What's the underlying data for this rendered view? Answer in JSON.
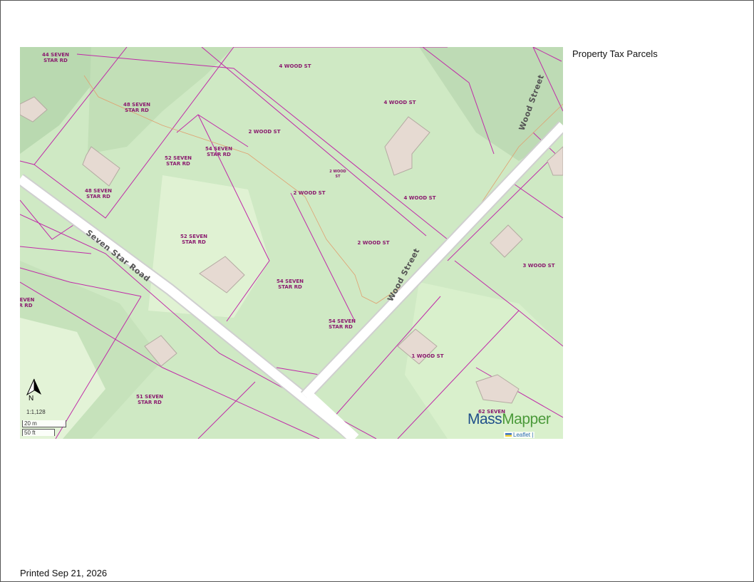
{
  "legend": {
    "title": "Property Tax Parcels"
  },
  "footer": {
    "printed": "Printed Sep 21, 2026"
  },
  "map": {
    "roads": [
      {
        "name": "Seven Star Road"
      },
      {
        "name": "Wood Street"
      },
      {
        "name": "Wood Street"
      }
    ],
    "parcels": [
      {
        "line1": "44 SEVEN",
        "line2": "STAR RD"
      },
      {
        "line1": "4 WOOD ST",
        "line2": ""
      },
      {
        "line1": "48 SEVEN",
        "line2": "STAR RD"
      },
      {
        "line1": "4 WOOD ST",
        "line2": ""
      },
      {
        "line1": "2 WOOD ST",
        "line2": ""
      },
      {
        "line1": "54 SEVEN",
        "line2": "STAR RD"
      },
      {
        "line1": "52 SEVEN",
        "line2": "STAR RD"
      },
      {
        "line1": "2 WOOD",
        "line2": "ST"
      },
      {
        "line1": "48 SEVEN",
        "line2": "STAR RD"
      },
      {
        "line1": "2 WOOD ST",
        "line2": ""
      },
      {
        "line1": "4 WOOD ST",
        "line2": ""
      },
      {
        "line1": "52 SEVEN",
        "line2": "STAR RD"
      },
      {
        "line1": "2 WOOD ST",
        "line2": ""
      },
      {
        "line1": "3 WOOD ST",
        "line2": ""
      },
      {
        "line1": "54 SEVEN",
        "line2": "STAR RD"
      },
      {
        "line1": "EVEN",
        "line2": "R RD"
      },
      {
        "line1": "54 SEVEN",
        "line2": "STAR RD"
      },
      {
        "line1": "1 WOOD ST",
        "line2": ""
      },
      {
        "line1": "51 SEVEN",
        "line2": "STAR RD"
      },
      {
        "line1": "62 SEVEN",
        "line2": ""
      }
    ],
    "scale_ratio": "1:1,128",
    "scale_metric": "20 m",
    "scale_imperial": "50 ft",
    "north_label": "N",
    "logo_part1": "Mass",
    "logo_part2": "Mapper",
    "attribution": "Leaflet |"
  },
  "colors": {
    "parcel_line": "#c02aa8",
    "road": "#ffffff",
    "terrain": "#cfe9c4"
  }
}
